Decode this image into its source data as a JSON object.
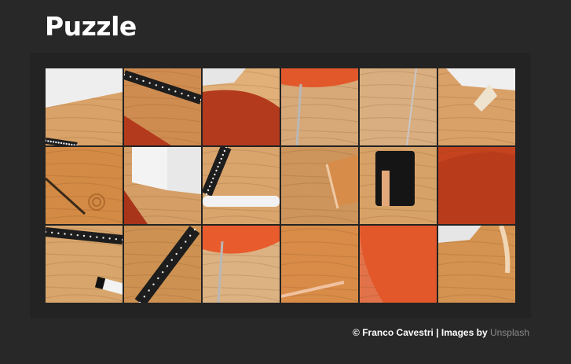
{
  "header": {
    "title": "Puzzle"
  },
  "footer": {
    "credit": "© Franco Cavestri | Images by",
    "link": "Unsplash"
  },
  "puzzle": {
    "rows": 3,
    "columns": 6,
    "tiles": [
      {
        "row": 0,
        "col": 0,
        "name": "paper-corner-on-wood",
        "bg": "#d9a268",
        "items": [
          "paper-top",
          "ruler-strip-bottom"
        ]
      },
      {
        "row": 0,
        "col": 1,
        "name": "ruler-over-chair",
        "bg": "#cf8c50",
        "items": [
          "ruler-diagonal",
          "chair-red-bottom"
        ]
      },
      {
        "row": 0,
        "col": 2,
        "name": "chair-back-left",
        "bg": "#e0b078",
        "items": [
          "chair-red-large",
          "paper-corner-topleft"
        ]
      },
      {
        "row": 0,
        "col": 3,
        "name": "chair-seat-edge",
        "bg": "#d7a878",
        "items": [
          "chair-orange-top",
          "chair-leg"
        ]
      },
      {
        "row": 0,
        "col": 4,
        "name": "wood-floor",
        "bg": "#d9ae80",
        "items": [
          "chair-leg-thin"
        ]
      },
      {
        "row": 0,
        "col": 5,
        "name": "paper-and-pencil",
        "bg": "#d9a068",
        "items": [
          "paper-top-right",
          "pencil-tip"
        ]
      },
      {
        "row": 1,
        "col": 0,
        "name": "leather-embossed",
        "bg": "#d38a45",
        "items": [
          "leather-stamp"
        ]
      },
      {
        "row": 1,
        "col": 1,
        "name": "paper-cards",
        "bg": "#d49e66",
        "items": [
          "cards-white",
          "chair-red-bottom-left"
        ]
      },
      {
        "row": 1,
        "col": 2,
        "name": "ruler-and-pencil",
        "bg": "#d9a56d",
        "items": [
          "ruler-black-vertical",
          "pencil-white"
        ]
      },
      {
        "row": 1,
        "col": 3,
        "name": "leather-edge",
        "bg": "#cd955b",
        "items": [
          "leather-corner"
        ]
      },
      {
        "row": 1,
        "col": 4,
        "name": "black-wallet",
        "bg": "#d6a267",
        "items": [
          "wallet-black"
        ]
      },
      {
        "row": 1,
        "col": 5,
        "name": "chair-red-right",
        "bg": "#c5431e",
        "items": [
          "chair-red-full"
        ]
      },
      {
        "row": 2,
        "col": 0,
        "name": "ruler-and-marker",
        "bg": "#d8a66c",
        "items": [
          "ruler-black-top",
          "marker"
        ]
      },
      {
        "row": 2,
        "col": 1,
        "name": "ruler-diagonal-wood",
        "bg": "#cd9152",
        "items": [
          "ruler-black-diagonal"
        ]
      },
      {
        "row": 2,
        "col": 2,
        "name": "chair-seat-floor",
        "bg": "#dcb283",
        "items": [
          "chair-orange-seat",
          "chair-leg"
        ]
      },
      {
        "row": 2,
        "col": 3,
        "name": "leather-plain",
        "bg": "#d88c48",
        "items": [
          "leather-edge-bottom"
        ]
      },
      {
        "row": 2,
        "col": 4,
        "name": "chair-orange-right",
        "bg": "#e2724a",
        "items": [
          "chair-orange-full"
        ]
      },
      {
        "row": 2,
        "col": 5,
        "name": "leather-and-strap",
        "bg": "#d49350",
        "items": [
          "paper-corner-topleft",
          "strap"
        ]
      }
    ]
  }
}
